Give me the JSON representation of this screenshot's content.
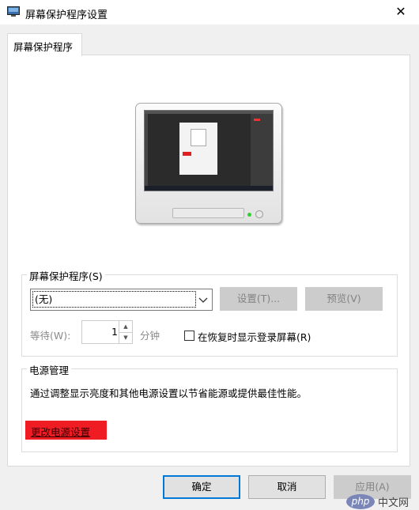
{
  "window": {
    "title": "屏幕保护程序设置",
    "close_glyph": "✕"
  },
  "tabs": [
    {
      "label": "屏幕保护程序"
    }
  ],
  "screensaver_group": {
    "legend": "屏幕保护程序(S)",
    "selected": "(无)",
    "settings_label": "设置(T)...",
    "preview_label": "预览(V)",
    "wait_label": "等待(W):",
    "wait_value": "1",
    "minutes_label": "分钟",
    "resume_checkbox_label": "在恢复时显示登录屏幕(R)",
    "resume_checked": false
  },
  "power_group": {
    "legend": "电源管理",
    "description": "通过调整显示亮度和其他电源设置以节省能源或提供最佳性能。",
    "link_label": "更改电源设置"
  },
  "footer": {
    "ok_label": "确定",
    "cancel_label": "取消",
    "apply_label": "应用(A)"
  },
  "watermark": {
    "logo": "php",
    "text": "中文网"
  },
  "colors": {
    "accent": "#0078d7",
    "highlight_red": "#ef1c24",
    "disabled_bg": "#cccccc"
  }
}
